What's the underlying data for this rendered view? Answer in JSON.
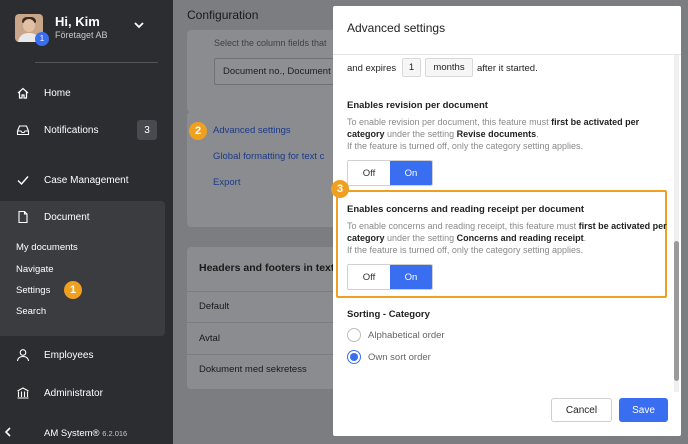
{
  "user": {
    "greeting": "Hi, Kim",
    "company": "Företaget AB",
    "badge": "1"
  },
  "sidebar": {
    "items": [
      {
        "label": "Home"
      },
      {
        "label": "Notifications",
        "count": "3"
      },
      {
        "label": "Case Management"
      },
      {
        "label": "Document"
      }
    ],
    "document_sub": [
      "My documents",
      "Navigate",
      "Settings",
      "Search"
    ],
    "bottom_items": [
      {
        "label": "Employees"
      },
      {
        "label": "Administrator"
      }
    ],
    "footer_name": "AM System®",
    "footer_version": "6.2.016"
  },
  "main": {
    "title": "Configuration",
    "column_hint": "Select the column fields that",
    "column_select": "Document no., Document",
    "links": [
      "Advanced settings",
      "Global formatting for text c",
      "Export"
    ],
    "headers_title": "Headers and footers in text",
    "header_rows": [
      "Default",
      "Avtal",
      "Dokument med sekretess"
    ]
  },
  "markers": [
    "1",
    "2",
    "3"
  ],
  "modal": {
    "title": "Advanced settings",
    "expires_prefix": "and expires",
    "expires_value": "1",
    "expires_unit": "months",
    "expires_suffix": "after it started.",
    "revision": {
      "title": "Enables revision per document",
      "desc_1": "To enable revision per document, this feature must ",
      "desc_bold_1": "first be activated per category",
      "desc_2": " under the setting ",
      "desc_bold_2": "Revise documents",
      "desc_3": ".",
      "desc_line_2": "If the feature is turned off, only the category setting applies.",
      "off_label": "Off",
      "on_label": "On"
    },
    "concerns": {
      "title": "Enables concerns and reading receipt per document",
      "desc_1": "To enable concerns and reading receipt, this feature must ",
      "desc_bold_1": "first be activated per category",
      "desc_2": " under the setting ",
      "desc_bold_2": "Concerns and reading receipt",
      "desc_3": ".",
      "desc_line_2": "If the feature is turned off, only the category setting applies.",
      "off_label": "Off",
      "on_label": "On"
    },
    "sorting": {
      "title": "Sorting - Category",
      "options": [
        "Alphabetical order",
        "Own sort order"
      ],
      "selected": "Own sort order"
    },
    "cancel_label": "Cancel",
    "save_label": "Save"
  },
  "colors": {
    "accent": "#3a6ef0",
    "marker": "#f0a020",
    "sidebar": "#2b2d30"
  }
}
